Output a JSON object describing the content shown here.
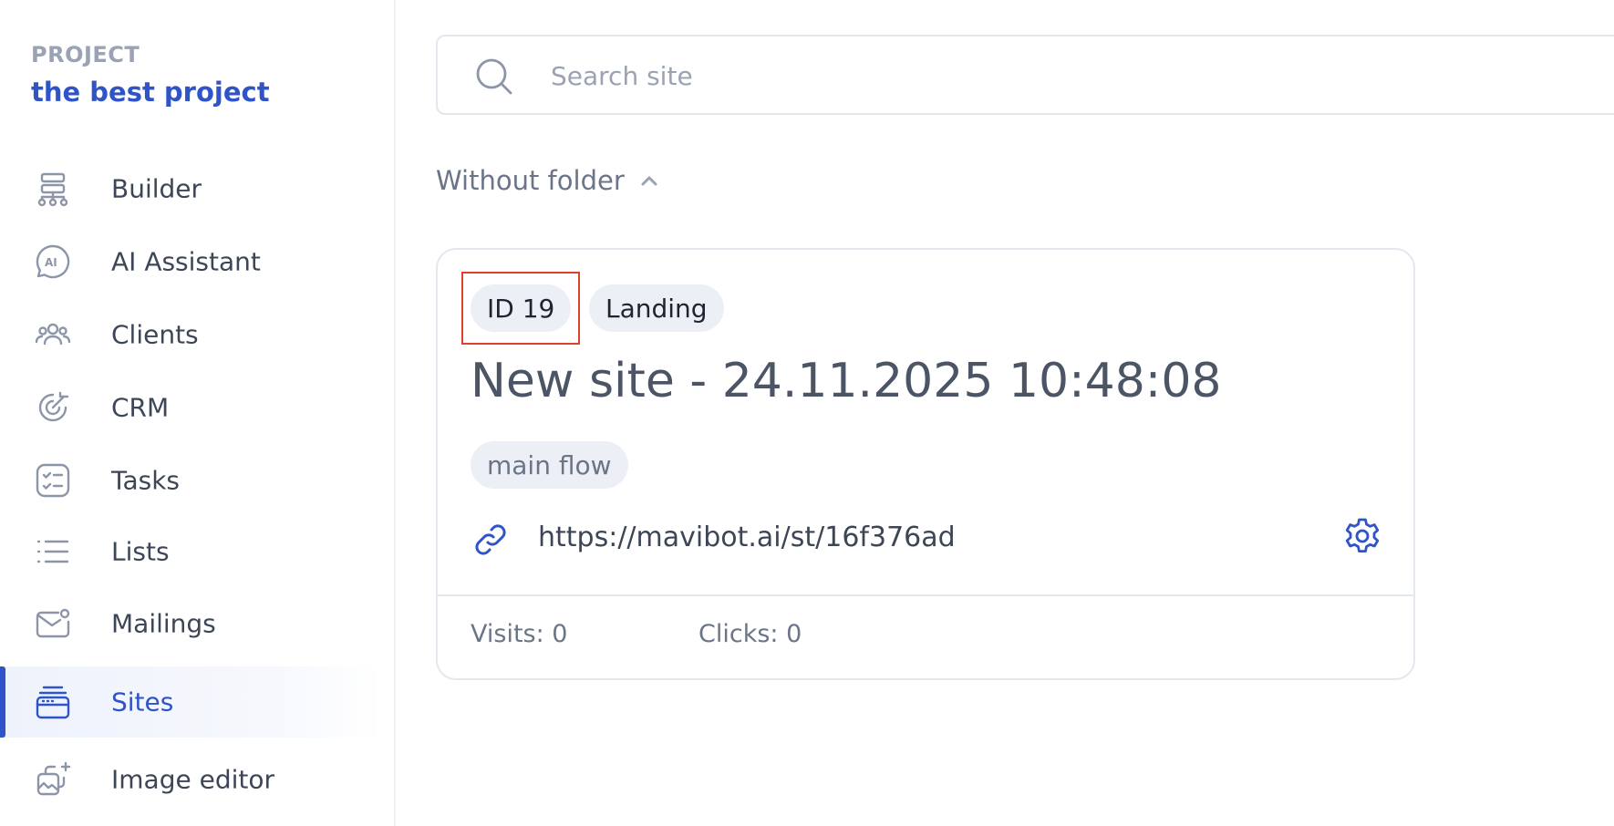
{
  "sidebar": {
    "project_label": "PROJECT",
    "project_name": "the best project",
    "items": [
      {
        "label": "Builder",
        "icon": "sitemap-icon"
      },
      {
        "label": "AI Assistant",
        "icon": "ai-chat-icon"
      },
      {
        "label": "Clients",
        "icon": "users-icon"
      },
      {
        "label": "CRM",
        "icon": "target-icon"
      },
      {
        "label": "Tasks",
        "icon": "checklist-icon"
      },
      {
        "label": "Lists",
        "icon": "list-icon"
      },
      {
        "label": "Mailings",
        "icon": "mail-icon"
      },
      {
        "label": "Sites",
        "icon": "browser-window-icon",
        "active": true
      },
      {
        "label": "Image editor",
        "icon": "image-edit-icon"
      }
    ]
  },
  "search": {
    "placeholder": "Search site",
    "value": ""
  },
  "folder": {
    "title": "Without folder",
    "expanded": true
  },
  "site_card": {
    "id_label": "ID 19",
    "type_label": "Landing",
    "title": "New site - 24.11.2025 10:48:08",
    "flow_tag": "main flow",
    "url": "https://mavibot.ai/st/16f376ad",
    "visits": "Visits: 0",
    "clicks": "Clicks: 0"
  },
  "colors": {
    "accent": "#2f54c8",
    "highlight_border": "#d9422d",
    "chip_bg": "#eceff5",
    "muted_text": "#9aa3b3"
  }
}
